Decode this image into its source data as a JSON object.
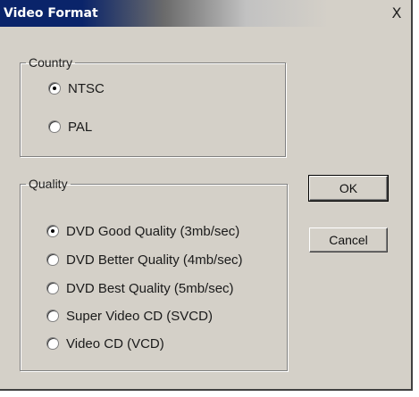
{
  "window": {
    "title": "Video Format",
    "close_label": "X"
  },
  "country": {
    "label": "Country",
    "options": [
      {
        "label": "NTSC",
        "selected": true
      },
      {
        "label": "PAL",
        "selected": false
      }
    ]
  },
  "quality": {
    "label": "Quality",
    "options": [
      {
        "label": "DVD Good Quality (3mb/sec)",
        "selected": true
      },
      {
        "label": "DVD Better Quality (4mb/sec)",
        "selected": false
      },
      {
        "label": "DVD Best Quality (5mb/sec)",
        "selected": false
      },
      {
        "label": "Super Video CD (SVCD)",
        "selected": false
      },
      {
        "label": "Video CD (VCD)",
        "selected": false
      }
    ]
  },
  "buttons": {
    "ok": "OK",
    "cancel": "Cancel"
  }
}
